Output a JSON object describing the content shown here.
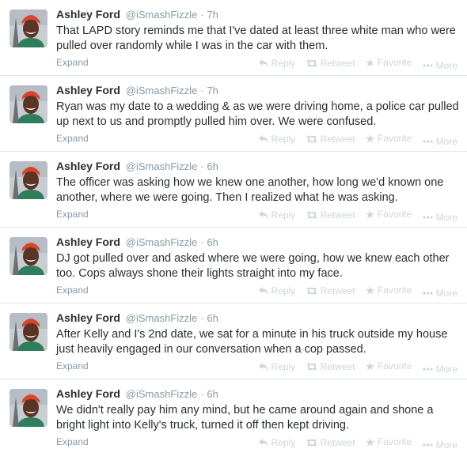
{
  "author": {
    "name": "Ashley Ford",
    "handle": "@iSmashFizzle",
    "separator": "·"
  },
  "actions": {
    "expand": "Expand",
    "reply": "Reply",
    "retweet": "Retweet",
    "favorite": "Favorite",
    "more": "More"
  },
  "colors": {
    "text": "#292f33",
    "muted": "#8899a6",
    "action_muted": "#ccd6dd",
    "divider": "#e1e8ed"
  },
  "tweets": [
    {
      "time": "7h",
      "text": "That LAPD story reminds me that I've dated at least three white man who were pulled over randomly while I was in the car with them."
    },
    {
      "time": "7h",
      "text": "Ryan was my date to a wedding & as we were driving home, a police car pulled up next to us and promptly pulled him over. We were confused."
    },
    {
      "time": "6h",
      "text": "The officer was asking how we knew one another, how long we'd known one another, where we were going. Then I realized what he was asking."
    },
    {
      "time": "6h",
      "text": "DJ got pulled over and asked where we were going, how we knew each other too. Cops always shone their lights straight into my face."
    },
    {
      "time": "6h",
      "text": "After Kelly and I's 2nd date, we sat for a minute in his truck outside my house just heavily engaged in our conversation when a cop passed."
    },
    {
      "time": "6h",
      "text": "We didn't really pay him any mind, but he came around again and shone a bright light into Kelly's truck, turned it off then kept driving."
    }
  ]
}
